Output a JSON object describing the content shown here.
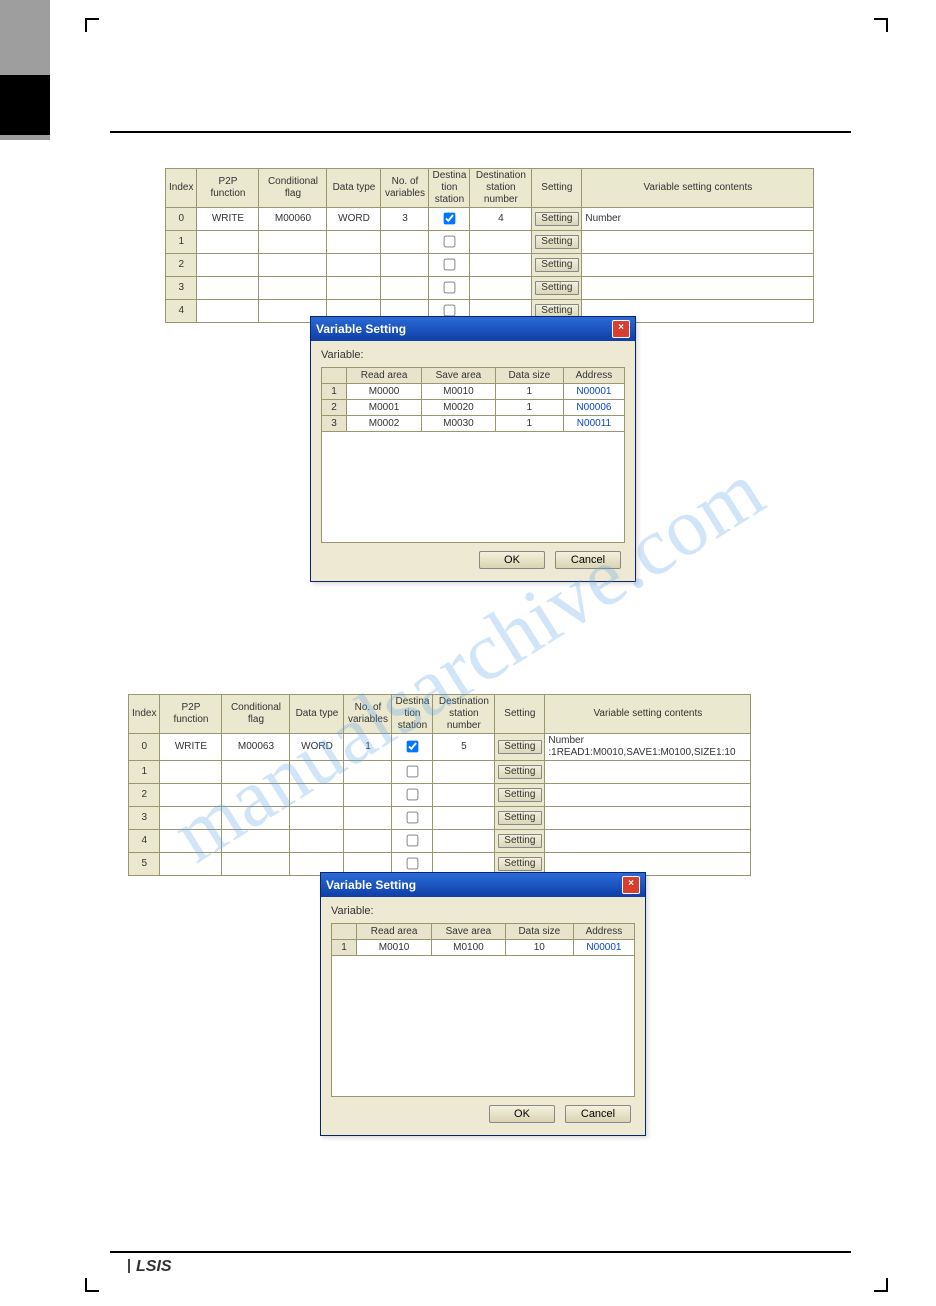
{
  "watermark": "manualsarchive.com",
  "logo": "LSIS",
  "table1": {
    "headers": [
      "Index",
      "P2P function",
      "Conditional flag",
      "Data type",
      "No. of variables",
      "Destination station",
      "Destination station number",
      "Setting",
      "Variable setting contents"
    ],
    "rows": [
      {
        "idx": "0",
        "func": "WRITE",
        "flag": "M00060",
        "dtype": "WORD",
        "nvar": "3",
        "dest_checked": true,
        "destnum": "4",
        "vsc": "Number"
      },
      {
        "idx": "1",
        "func": "",
        "flag": "",
        "dtype": "",
        "nvar": "",
        "dest_checked": false,
        "destnum": "",
        "vsc": ""
      },
      {
        "idx": "2",
        "func": "",
        "flag": "",
        "dtype": "",
        "nvar": "",
        "dest_checked": false,
        "destnum": "",
        "vsc": ""
      },
      {
        "idx": "3",
        "func": "",
        "flag": "",
        "dtype": "",
        "nvar": "",
        "dest_checked": false,
        "destnum": "",
        "vsc": ""
      },
      {
        "idx": "4",
        "func": "",
        "flag": "",
        "dtype": "",
        "nvar": "",
        "dest_checked": false,
        "destnum": "",
        "vsc": ""
      }
    ],
    "setting_label": "Setting"
  },
  "dialog1": {
    "title": "Variable Setting",
    "label": "Variable:",
    "headers": [
      "",
      "Read area",
      "Save area",
      "Data size",
      "Address"
    ],
    "rows": [
      {
        "n": "1",
        "read": "M0000",
        "save": "M0010",
        "size": "1",
        "addr": "N00001"
      },
      {
        "n": "2",
        "read": "M0001",
        "save": "M0020",
        "size": "1",
        "addr": "N00006"
      },
      {
        "n": "3",
        "read": "M0002",
        "save": "M0030",
        "size": "1",
        "addr": "N00011"
      }
    ],
    "ok": "OK",
    "cancel": "Cancel"
  },
  "table2": {
    "headers": [
      "Index",
      "P2P function",
      "Conditional flag",
      "Data type",
      "No. of variables",
      "Destination station",
      "Destination station number",
      "Setting",
      "Variable setting contents"
    ],
    "rows": [
      {
        "idx": "0",
        "func": "WRITE",
        "flag": "M00063",
        "dtype": "WORD",
        "nvar": "1",
        "dest_checked": true,
        "destnum": "5",
        "vsc": "Number :1READ1:M0010,SAVE1:M0100,SIZE1:10"
      },
      {
        "idx": "1",
        "func": "",
        "flag": "",
        "dtype": "",
        "nvar": "",
        "dest_checked": false,
        "destnum": "",
        "vsc": ""
      },
      {
        "idx": "2",
        "func": "",
        "flag": "",
        "dtype": "",
        "nvar": "",
        "dest_checked": false,
        "destnum": "",
        "vsc": ""
      },
      {
        "idx": "3",
        "func": "",
        "flag": "",
        "dtype": "",
        "nvar": "",
        "dest_checked": false,
        "destnum": "",
        "vsc": ""
      },
      {
        "idx": "4",
        "func": "",
        "flag": "",
        "dtype": "",
        "nvar": "",
        "dest_checked": false,
        "destnum": "",
        "vsc": ""
      },
      {
        "idx": "5",
        "func": "",
        "flag": "",
        "dtype": "",
        "nvar": "",
        "dest_checked": false,
        "destnum": "",
        "vsc": ""
      }
    ],
    "setting_label": "Setting"
  },
  "dialog2": {
    "title": "Variable Setting",
    "label": "Variable:",
    "headers": [
      "",
      "Read area",
      "Save area",
      "Data size",
      "Address"
    ],
    "rows": [
      {
        "n": "1",
        "read": "M0010",
        "save": "M0100",
        "size": "10",
        "addr": "N00001"
      }
    ],
    "ok": "OK",
    "cancel": "Cancel"
  }
}
